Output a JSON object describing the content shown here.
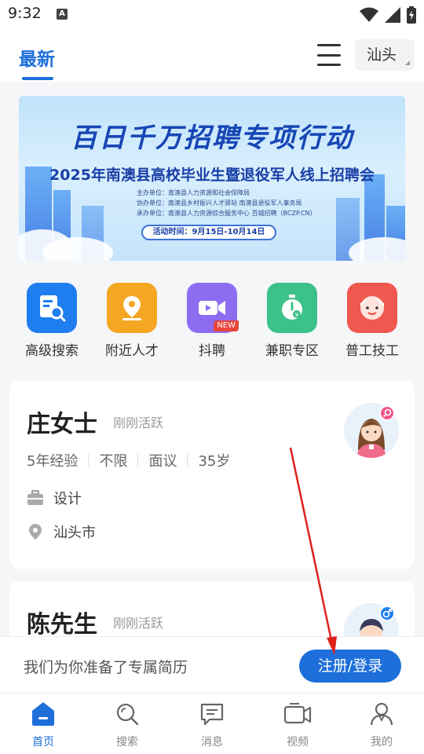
{
  "status": {
    "time": "9:32",
    "a_badge": "A"
  },
  "topnav": {
    "tab_label": "最新",
    "city": "汕头"
  },
  "banner": {
    "title1": "百日千万招聘专项行动",
    "title2": "2025年南澳县高校毕业生暨退役军人线上招聘会",
    "lines": [
      "主办单位：南澳县人力资源和社会保障局",
      "协办单位：南澳县乡村振兴人才驿站  南澳县退役军人事务局",
      "承办单位：南澳县人力资源综合服务中心  百城招聘（BCZP.CN）"
    ],
    "time_label": "活动时间：9月15日-10月14日"
  },
  "quick_entries": [
    {
      "label": "高级搜索",
      "icon": "advanced-search-icon",
      "color": "#1e7ef0"
    },
    {
      "label": "附近人才",
      "icon": "location-pin-icon",
      "color": "#f5a623"
    },
    {
      "label": "抖聘",
      "icon": "video-camera-icon",
      "color": "#8e6cf0",
      "badge": "NEW"
    },
    {
      "label": "兼职专区",
      "icon": "stopwatch-icon",
      "color": "#3cc18a"
    },
    {
      "label": "普工技工",
      "icon": "worker-face-icon",
      "color": "#f0574f"
    }
  ],
  "candidates": [
    {
      "name": "庄女士",
      "status": "刚刚活跃",
      "tags": [
        "5年经验",
        "不限",
        "面议",
        "35岁"
      ],
      "job": "设计",
      "location": "汕头市",
      "gender": "female"
    },
    {
      "name": "陈先生",
      "status": "刚刚活跃",
      "gender": "male"
    }
  ],
  "register_bar": {
    "text": "我们为你准备了专属简历",
    "button": "注册/登录"
  },
  "tabbar": {
    "items": [
      {
        "label": "首页",
        "icon": "home-icon"
      },
      {
        "label": "搜索",
        "icon": "search-icon"
      },
      {
        "label": "消息",
        "icon": "message-icon"
      },
      {
        "label": "视频",
        "icon": "video-icon"
      },
      {
        "label": "我的",
        "icon": "profile-icon"
      }
    ],
    "active_index": 0
  },
  "colors": {
    "primary": "#1e6fd9",
    "annotation_arrow": "#e0201b"
  }
}
